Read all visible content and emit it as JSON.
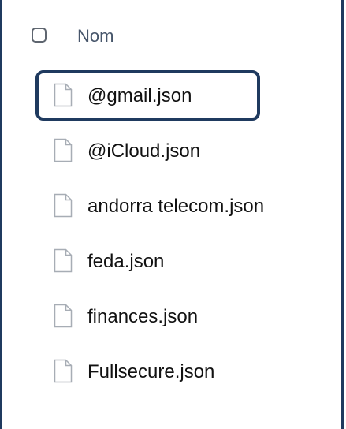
{
  "header": {
    "column_label": "Nom"
  },
  "files": [
    {
      "name": "@gmail.json",
      "selected": true,
      "icon": "file-icon"
    },
    {
      "name": "@iCloud.json",
      "selected": false,
      "icon": "file-icon"
    },
    {
      "name": "andorra telecom.json",
      "selected": false,
      "icon": "file-icon"
    },
    {
      "name": "feda.json",
      "selected": false,
      "icon": "file-icon"
    },
    {
      "name": "finances.json",
      "selected": false,
      "icon": "file-icon"
    },
    {
      "name": "Fullsecure.json",
      "selected": false,
      "icon": "file-icon"
    }
  ],
  "colors": {
    "frame": "#1f3a5f",
    "header_text": "#47566b",
    "file_text": "#111111",
    "icon_stroke": "#a7adb5"
  }
}
